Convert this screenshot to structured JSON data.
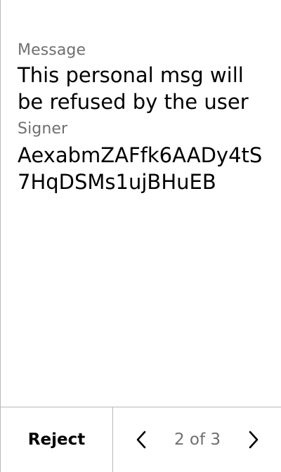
{
  "message": {
    "label": "Message",
    "value": "This personal msg will be refused by the user"
  },
  "signer": {
    "label": "Signer",
    "value": "AexabmZAFfk6AADy4tS7HqDSMs1ujBHuEB"
  },
  "footer": {
    "reject_label": "Reject",
    "page_indicator": "2 of 3",
    "prev_icon": "chevron-left-icon",
    "next_icon": "chevron-right-icon"
  },
  "colors": {
    "background": "#ffffff",
    "text_primary": "#000000",
    "text_secondary": "#6f6f6f",
    "divider": "#b8b8b8"
  }
}
